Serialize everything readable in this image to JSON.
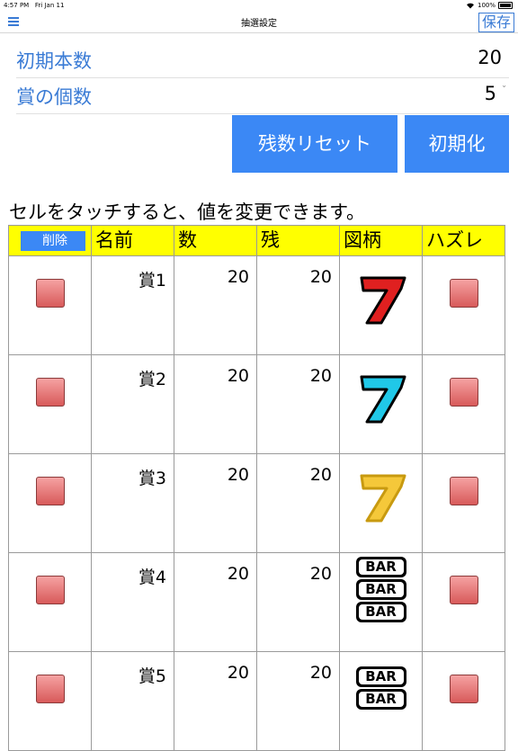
{
  "status_bar": {
    "time": "4:57 PM",
    "date": "Fri Jan 11",
    "wifi_icon": "wifi-icon",
    "battery": "100%"
  },
  "nav": {
    "title": "抽選設定",
    "save_label": "保存",
    "menu_icon": "menu-icon"
  },
  "settings": [
    {
      "label": "初期本数",
      "value": "20"
    },
    {
      "label": "賞の個数",
      "value": "5"
    }
  ],
  "buttons": {
    "reset_remaining": "残数リセット",
    "initialize": "初期化"
  },
  "instructions": "セルをタッチすると、値を変更できます。",
  "table": {
    "delete_label": "削除",
    "headers": {
      "name": "名前",
      "count": "数",
      "remaining": "残",
      "symbol": "図柄",
      "miss": "ハズレ"
    },
    "rows": [
      {
        "name": "賞1",
        "count": "20",
        "remaining": "20",
        "symbol": "red-seven-icon",
        "color": "#e02020"
      },
      {
        "name": "賞2",
        "count": "20",
        "remaining": "20",
        "symbol": "cyan-seven-icon",
        "color": "#20c8e8"
      },
      {
        "name": "賞3",
        "count": "20",
        "remaining": "20",
        "symbol": "gold-seven-icon",
        "color": "#f5c83a"
      },
      {
        "name": "賞4",
        "count": "20",
        "remaining": "20",
        "symbol": "triple-bar-icon",
        "bar_text": "BAR"
      },
      {
        "name": "賞5",
        "count": "20",
        "remaining": "20",
        "symbol": "double-bar-icon",
        "bar_text": "BAR"
      }
    ]
  },
  "colors": {
    "accent": "#3a7bd5",
    "button_bg": "#3b88f5",
    "header_bg": "#ffff00",
    "checkbox": "#d85a5a"
  }
}
